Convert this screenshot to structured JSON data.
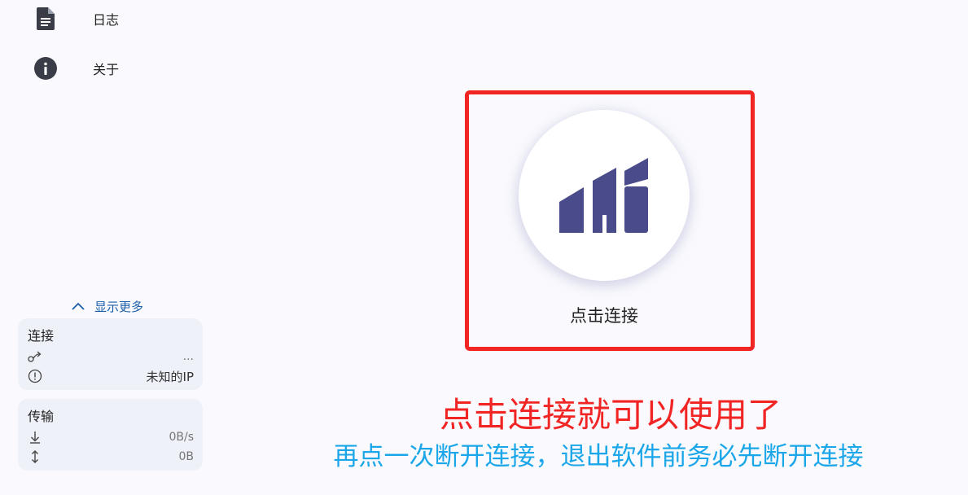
{
  "sidebar": {
    "nav": [
      {
        "label": "日志",
        "icon": "document-icon"
      },
      {
        "label": "关于",
        "icon": "info-icon"
      }
    ],
    "show_more": {
      "label": "显示更多",
      "icon": "chevron-up-icon"
    },
    "connection_card": {
      "title": "连接",
      "rows": [
        {
          "icon": "route-icon",
          "value": "..."
        },
        {
          "icon": "alert-circle-icon",
          "value": "未知的IP"
        }
      ]
    },
    "transfer_card": {
      "title": "传输",
      "rows": [
        {
          "icon": "arrow-down-icon",
          "value": "0B/s"
        },
        {
          "icon": "arrow-up-down-icon",
          "value": "0B"
        }
      ]
    }
  },
  "main": {
    "connect_button": {
      "label": "点击连接",
      "icon": "hi-logo-icon",
      "logo_color": "#4a4b8a"
    },
    "annotation_primary": "点击连接就可以使用了",
    "annotation_secondary": "再点一次断开连接，退出软件前务必先断开连接",
    "highlight_color": "#f22525",
    "annotation_secondary_color": "#1aa6e8"
  }
}
